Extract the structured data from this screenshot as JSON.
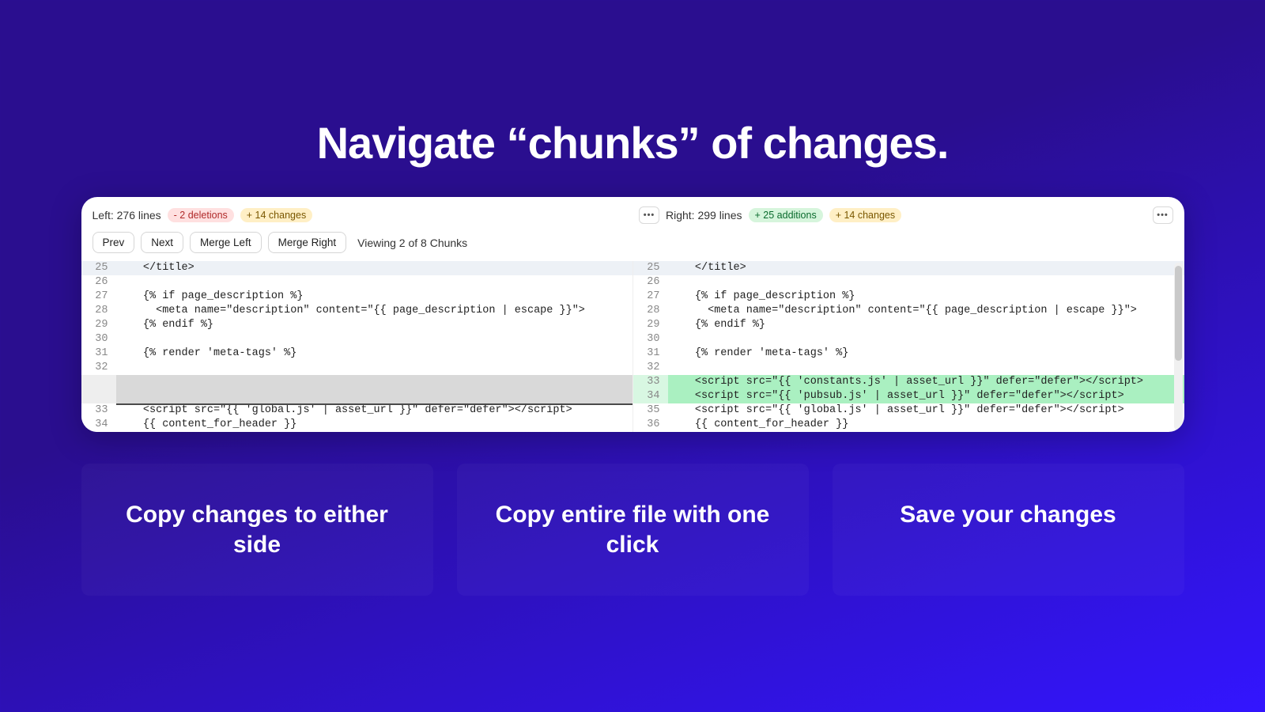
{
  "title": "Navigate “chunks” of changes.",
  "left": {
    "label": "Left: 276 lines",
    "deletions": "- 2 deletions",
    "changes": "+ 14 changes"
  },
  "right": {
    "label": "Right: 299 lines",
    "additions": "+ 25 additions",
    "changes": "+ 14 changes"
  },
  "buttons": {
    "prev": "Prev",
    "next": "Next",
    "mergeLeft": "Merge Left",
    "mergeRight": "Merge Right",
    "more": "•••"
  },
  "chunkStatus": "Viewing 2 of 8 Chunks",
  "leftLines": [
    {
      "n": "25",
      "t": "    </title>",
      "cls": "hl"
    },
    {
      "n": "26",
      "t": ""
    },
    {
      "n": "27",
      "t": "    {% if page_description %}"
    },
    {
      "n": "28",
      "t": "      <meta name=\"description\" content=\"{{ page_description | escape }}\">"
    },
    {
      "n": "29",
      "t": "    {% endif %}"
    },
    {
      "n": "30",
      "t": ""
    },
    {
      "n": "31",
      "t": "    {% render 'meta-tags' %}"
    },
    {
      "n": "32",
      "t": ""
    },
    {
      "n": "",
      "t": "",
      "cls": "gap"
    },
    {
      "n": "",
      "t": "",
      "cls": "gap"
    },
    {
      "n": "33",
      "t": "    <script src=\"{{ 'global.js' | asset_url }}\" defer=\"defer\"></scr_ipt>",
      "cls": "insert-bar"
    },
    {
      "n": "34",
      "t": "    {{ content_for_header }}"
    }
  ],
  "rightLines": [
    {
      "n": "25",
      "t": "    </title>",
      "cls": "hl"
    },
    {
      "n": "26",
      "t": ""
    },
    {
      "n": "27",
      "t": "    {% if page_description %}"
    },
    {
      "n": "28",
      "t": "      <meta name=\"description\" content=\"{{ page_description | escape }}\">"
    },
    {
      "n": "29",
      "t": "    {% endif %}"
    },
    {
      "n": "30",
      "t": ""
    },
    {
      "n": "31",
      "t": "    {% render 'meta-tags' %}"
    },
    {
      "n": "32",
      "t": ""
    },
    {
      "n": "33",
      "t": "    <script src=\"{{ 'constants.js' | asset_url }}\" defer=\"defer\"></scr_ipt>",
      "cls": "add"
    },
    {
      "n": "34",
      "t": "    <script src=\"{{ 'pubsub.js' | asset_url }}\" defer=\"defer\"></scr_ipt>",
      "cls": "add"
    },
    {
      "n": "35",
      "t": "    <script src=\"{{ 'global.js' | asset_url }}\" defer=\"defer\"></scr_ipt>"
    },
    {
      "n": "36",
      "t": "    {{ content_for_header }}"
    }
  ],
  "features": [
    "Copy changes to either side",
    "Copy entire file with one click",
    "Save your changes"
  ]
}
